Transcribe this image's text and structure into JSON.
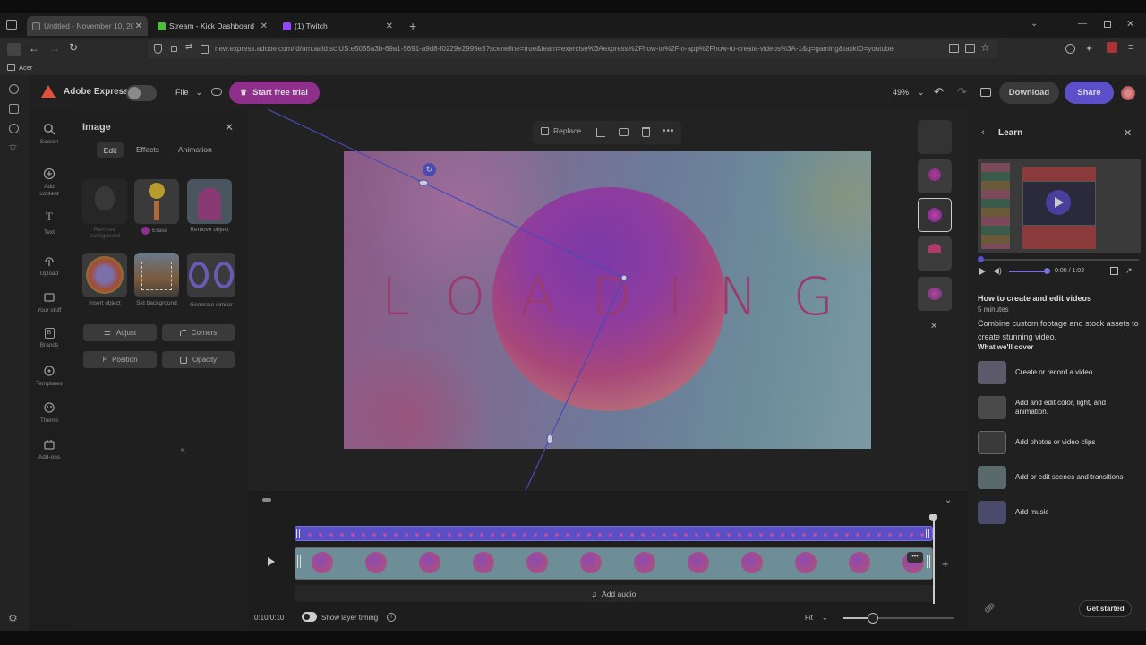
{
  "browser": {
    "tabs": [
      {
        "title": "Untitled - November 10, 2025 a",
        "active": true
      },
      {
        "title": "Stream - Kick Dashboard",
        "active": false
      },
      {
        "title": "(1) Twitch",
        "active": false
      }
    ],
    "url": "new.express.adobe.com/id/urn:aaid:sc:US:e5055a3b-69a1-5691-a9d8-f0229e2995e3?sceneline=true&learn=exercise%3Aexpress%2Fhow-to%2Fin-app%2Fhow-to-create-videos%3A-1&q=gaming&taskID=youtube",
    "url_domain": "adobe.com",
    "bookmark": "Acer"
  },
  "app": {
    "name": "Adobe Express",
    "file_menu": "File",
    "trial_button": "Start free trial",
    "zoom": "49%",
    "download_button": "Download",
    "share_button": "Share"
  },
  "rail": [
    {
      "label": "Search",
      "icon": "search-icon"
    },
    {
      "label": "Add content",
      "icon": "plus-circle-icon"
    },
    {
      "label": "Text",
      "icon": "text-icon"
    },
    {
      "label": "Upload",
      "icon": "upload-icon"
    },
    {
      "label": "Your stuff",
      "icon": "folder-icon"
    },
    {
      "label": "Brands",
      "icon": "brand-icon"
    },
    {
      "label": "Templates",
      "icon": "templates-icon"
    },
    {
      "label": "Theme",
      "icon": "palette-icon"
    },
    {
      "label": "Add-ons",
      "icon": "addons-icon"
    }
  ],
  "panel": {
    "title": "Image",
    "tabs": [
      "Edit",
      "Effects",
      "Animation"
    ],
    "active_tab": "Edit",
    "tools": [
      {
        "label": "Remove background"
      },
      {
        "label": "Erase"
      },
      {
        "label": "Remove object"
      },
      {
        "label": "Insert object"
      },
      {
        "label": "Set background"
      },
      {
        "label": "Generate similar"
      }
    ],
    "buttons": [
      "Adjust",
      "Corners",
      "Position",
      "Opacity"
    ]
  },
  "canvas": {
    "toolbar_replace": "Replace",
    "loading_text": "LOADING"
  },
  "timeline": {
    "add_audio": "Add audio",
    "time": "0:10/0:10",
    "layer_timing": "Show layer timing",
    "fit": "Fit"
  },
  "learn": {
    "title": "Learn",
    "player_time": "0:00 / 1:02",
    "course_title": "How to create and edit videos",
    "duration": "5 minutes",
    "description": "Combine custom footage and stock assets to create stunning video.",
    "cover_heading": "What we'll cover",
    "items": [
      "Create or record a video",
      "Add and edit color, light, and animation.",
      "Add photos or video clips",
      "Add or edit scenes and transitions",
      "Add music"
    ],
    "get_started": "Get started"
  },
  "colors": {
    "accent_purple": "#5c4fc9",
    "trial_magenta": "#8e2f8c",
    "dim_overlay": "#1e1e1e"
  }
}
